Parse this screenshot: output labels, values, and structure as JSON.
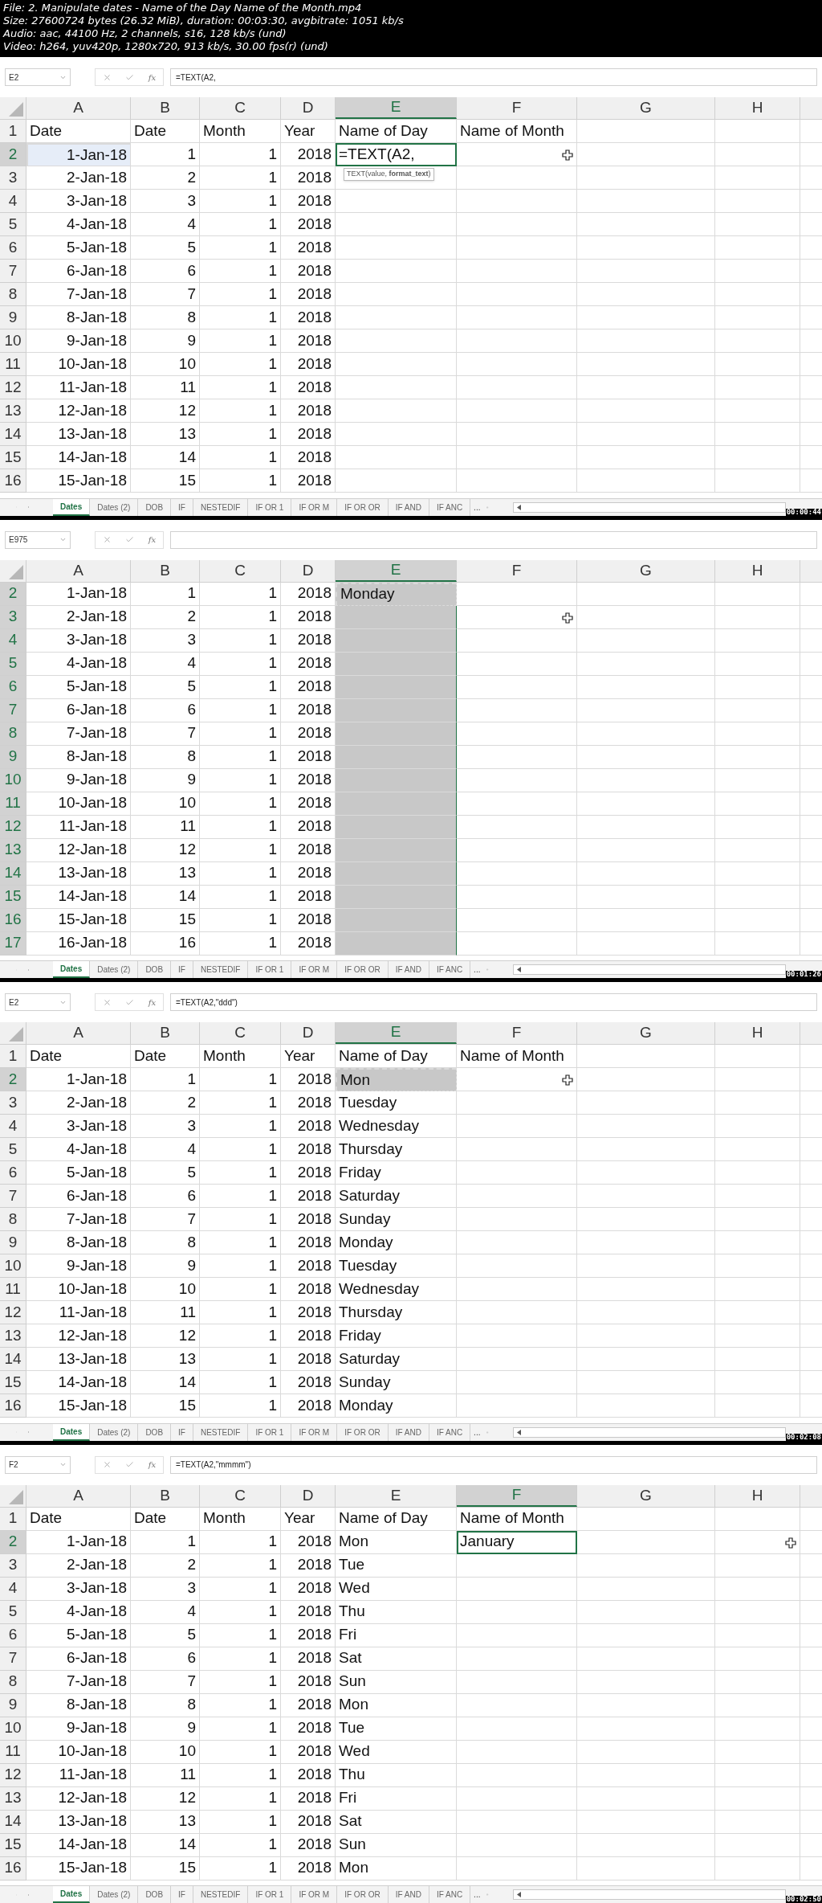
{
  "file_info": [
    "File: 2. Manipulate dates - Name of the Day  Name of the Month.mp4",
    "Size: 27600724 bytes (26.32 MiB), duration: 00:03:30, avgbitrate: 1051 kb/s",
    "Audio: aac, 44100 Hz, 2 channels, s16, 128 kb/s (und)",
    "Video: h264, yuv420p, 1280x720, 913 kb/s, 30.00 fps(r) (und)"
  ],
  "frames": [
    {
      "name_box": "E2",
      "function_label": "fx",
      "formula": "=TEXT(A2,",
      "timestamp": "00:00:44",
      "columns": [
        {
          "label": "A",
          "selected": false
        },
        {
          "label": "B",
          "selected": false
        },
        {
          "label": "C",
          "selected": false
        },
        {
          "label": "D",
          "selected": false
        },
        {
          "label": "E",
          "selected": true
        },
        {
          "label": "F",
          "selected": false
        },
        {
          "label": "G",
          "selected": false
        },
        {
          "label": "H",
          "selected": false
        }
      ],
      "rows": [
        {
          "number": "1",
          "kind": "header",
          "selected": false,
          "cells": [
            "Date",
            "Date",
            "Month",
            "Year",
            "Name of Day",
            "Name of Month"
          ]
        },
        {
          "number": "2",
          "kind": "data",
          "selected": true,
          "cells": [
            {
              "text": "1-Jan-18",
              "kind": "reference"
            },
            "1",
            "1",
            "2018",
            {
              "text": "=TEXT(A2,",
              "kind": "edit",
              "tooltip": "TEXT(value, **format_text**)"
            },
            {
              "kind": "cursor"
            }
          ]
        },
        {
          "number": "3",
          "kind": "data",
          "selected": false,
          "cells": [
            "2-Jan-18",
            "2",
            "1",
            "2018"
          ]
        },
        {
          "number": "4",
          "kind": "data",
          "selected": false,
          "cells": [
            "3-Jan-18",
            "3",
            "1",
            "2018"
          ]
        },
        {
          "number": "5",
          "kind": "data",
          "selected": false,
          "cells": [
            "4-Jan-18",
            "4",
            "1",
            "2018"
          ]
        },
        {
          "number": "6",
          "kind": "data",
          "selected": false,
          "cells": [
            "5-Jan-18",
            "5",
            "1",
            "2018"
          ]
        },
        {
          "number": "7",
          "kind": "data",
          "selected": false,
          "cells": [
            "6-Jan-18",
            "6",
            "1",
            "2018"
          ]
        },
        {
          "number": "8",
          "kind": "data",
          "selected": false,
          "cells": [
            "7-Jan-18",
            "7",
            "1",
            "2018"
          ]
        },
        {
          "number": "9",
          "kind": "data",
          "selected": false,
          "cells": [
            "8-Jan-18",
            "8",
            "1",
            "2018"
          ]
        },
        {
          "number": "10",
          "kind": "data",
          "selected": false,
          "cells": [
            "9-Jan-18",
            "9",
            "1",
            "2018"
          ]
        },
        {
          "number": "11",
          "kind": "data",
          "selected": false,
          "cells": [
            "10-Jan-18",
            "10",
            "1",
            "2018"
          ]
        },
        {
          "number": "12",
          "kind": "data",
          "selected": false,
          "cells": [
            "11-Jan-18",
            "11",
            "1",
            "2018"
          ]
        },
        {
          "number": "13",
          "kind": "data",
          "selected": false,
          "cells": [
            "12-Jan-18",
            "12",
            "1",
            "2018"
          ]
        },
        {
          "number": "14",
          "kind": "data",
          "selected": false,
          "cells": [
            "13-Jan-18",
            "13",
            "1",
            "2018"
          ]
        },
        {
          "number": "15",
          "kind": "data",
          "selected": false,
          "cells": [
            "14-Jan-18",
            "14",
            "1",
            "2018"
          ]
        },
        {
          "number": "16",
          "kind": "data",
          "selected": false,
          "cells": [
            "15-Jan-18",
            "15",
            "1",
            "2018"
          ]
        }
      ],
      "tabs": [
        {
          "label": "Dates",
          "selected": true
        },
        {
          "label": "Dates (2)",
          "selected": false
        },
        {
          "label": "DOB",
          "selected": false
        },
        {
          "label": "IF",
          "selected": false
        },
        {
          "label": "NESTEDIF",
          "selected": false
        },
        {
          "label": "IF OR 1",
          "selected": false
        },
        {
          "label": "IF OR M",
          "selected": false
        },
        {
          "label": "IF OR OR",
          "selected": false
        },
        {
          "label": "IF AND",
          "selected": false
        },
        {
          "label": "IF ANC",
          "selected": false
        }
      ],
      "more_tabs": "..."
    },
    {
      "name_box": "E975",
      "function_label": "fx",
      "timestamp": "00:01:26",
      "columns": [
        {
          "label": "A",
          "selected": false
        },
        {
          "label": "B",
          "selected": false
        },
        {
          "label": "C",
          "selected": false
        },
        {
          "label": "D",
          "selected": false
        },
        {
          "label": "E",
          "selected": true
        },
        {
          "label": "F",
          "selected": false
        },
        {
          "label": "G",
          "selected": false
        },
        {
          "label": "H",
          "selected": false
        }
      ],
      "rows": [
        {
          "number": "2",
          "kind": "data",
          "selected": true,
          "cells": [
            "1-Jan-18",
            "1",
            "1",
            "2018",
            {
              "text": "Monday",
              "kind": "copy"
            }
          ]
        },
        {
          "number": "3",
          "kind": "data",
          "selected": true,
          "cells": [
            "2-Jan-18",
            "2",
            "1",
            "2018",
            {
              "kind": "range"
            },
            {
              "kind": "cursor"
            }
          ]
        },
        {
          "number": "4",
          "kind": "data",
          "selected": true,
          "cells": [
            "3-Jan-18",
            "3",
            "1",
            "2018",
            {
              "kind": "range"
            }
          ]
        },
        {
          "number": "5",
          "kind": "data",
          "selected": true,
          "cells": [
            "4-Jan-18",
            "4",
            "1",
            "2018",
            {
              "kind": "range"
            }
          ]
        },
        {
          "number": "6",
          "kind": "data",
          "selected": true,
          "cells": [
            "5-Jan-18",
            "5",
            "1",
            "2018",
            {
              "kind": "range"
            }
          ]
        },
        {
          "number": "7",
          "kind": "data",
          "selected": true,
          "cells": [
            "6-Jan-18",
            "6",
            "1",
            "2018",
            {
              "kind": "range"
            }
          ]
        },
        {
          "number": "8",
          "kind": "data",
          "selected": true,
          "cells": [
            "7-Jan-18",
            "7",
            "1",
            "2018",
            {
              "kind": "range"
            }
          ]
        },
        {
          "number": "9",
          "kind": "data",
          "selected": true,
          "cells": [
            "8-Jan-18",
            "8",
            "1",
            "2018",
            {
              "kind": "range"
            }
          ]
        },
        {
          "number": "10",
          "kind": "data",
          "selected": true,
          "cells": [
            "9-Jan-18",
            "9",
            "1",
            "2018",
            {
              "kind": "range"
            }
          ]
        },
        {
          "number": "11",
          "kind": "data",
          "selected": true,
          "cells": [
            "10-Jan-18",
            "10",
            "1",
            "2018",
            {
              "kind": "range"
            }
          ]
        },
        {
          "number": "12",
          "kind": "data",
          "selected": true,
          "cells": [
            "11-Jan-18",
            "11",
            "1",
            "2018",
            {
              "kind": "range"
            }
          ]
        },
        {
          "number": "13",
          "kind": "data",
          "selected": true,
          "cells": [
            "12-Jan-18",
            "12",
            "1",
            "2018",
            {
              "kind": "range"
            }
          ]
        },
        {
          "number": "14",
          "kind": "data",
          "selected": true,
          "cells": [
            "13-Jan-18",
            "13",
            "1",
            "2018",
            {
              "kind": "range"
            }
          ]
        },
        {
          "number": "15",
          "kind": "data",
          "selected": true,
          "cells": [
            "14-Jan-18",
            "14",
            "1",
            "2018",
            {
              "kind": "range"
            }
          ]
        },
        {
          "number": "16",
          "kind": "data",
          "selected": true,
          "cells": [
            "15-Jan-18",
            "15",
            "1",
            "2018",
            {
              "kind": "range"
            }
          ]
        },
        {
          "number": "17",
          "kind": "data",
          "selected": true,
          "cells": [
            "16-Jan-18",
            "16",
            "1",
            "2018",
            {
              "kind": "range"
            }
          ]
        }
      ],
      "tabs": [
        {
          "label": "Dates",
          "selected": true
        },
        {
          "label": "Dates (2)",
          "selected": false
        },
        {
          "label": "DOB",
          "selected": false
        },
        {
          "label": "IF",
          "selected": false
        },
        {
          "label": "NESTEDIF",
          "selected": false
        },
        {
          "label": "IF OR 1",
          "selected": false
        },
        {
          "label": "IF OR M",
          "selected": false
        },
        {
          "label": "IF OR OR",
          "selected": false
        },
        {
          "label": "IF AND",
          "selected": false
        },
        {
          "label": "IF ANC",
          "selected": false
        }
      ],
      "more_tabs": "..."
    },
    {
      "name_box": "E2",
      "function_label": "fx",
      "formula": "=TEXT(A2,\"ddd\")",
      "timestamp": "00:02:08",
      "columns": [
        {
          "label": "A",
          "selected": false
        },
        {
          "label": "B",
          "selected": false
        },
        {
          "label": "C",
          "selected": false
        },
        {
          "label": "D",
          "selected": false
        },
        {
          "label": "E",
          "selected": true
        },
        {
          "label": "F",
          "selected": false
        },
        {
          "label": "G",
          "selected": false
        },
        {
          "label": "H",
          "selected": false
        }
      ],
      "rows": [
        {
          "number": "1",
          "kind": "header",
          "selected": false,
          "cells": [
            "Date",
            "Date",
            "Month",
            "Year",
            "Name of Day",
            "Name of Month"
          ]
        },
        {
          "number": "2",
          "kind": "data",
          "selected": true,
          "cells": [
            "1-Jan-18",
            "1",
            "1",
            "2018",
            {
              "text": "Mon",
              "kind": "copy"
            },
            {
              "kind": "cursor"
            }
          ]
        },
        {
          "number": "3",
          "kind": "data",
          "selected": false,
          "cells": [
            "2-Jan-18",
            "2",
            "1",
            "2018",
            "Tuesday"
          ]
        },
        {
          "number": "4",
          "kind": "data",
          "selected": false,
          "cells": [
            "3-Jan-18",
            "3",
            "1",
            "2018",
            "Wednesday"
          ]
        },
        {
          "number": "5",
          "kind": "data",
          "selected": false,
          "cells": [
            "4-Jan-18",
            "4",
            "1",
            "2018",
            "Thursday"
          ]
        },
        {
          "number": "6",
          "kind": "data",
          "selected": false,
          "cells": [
            "5-Jan-18",
            "5",
            "1",
            "2018",
            "Friday"
          ]
        },
        {
          "number": "7",
          "kind": "data",
          "selected": false,
          "cells": [
            "6-Jan-18",
            "6",
            "1",
            "2018",
            "Saturday"
          ]
        },
        {
          "number": "8",
          "kind": "data",
          "selected": false,
          "cells": [
            "7-Jan-18",
            "7",
            "1",
            "2018",
            "Sunday"
          ]
        },
        {
          "number": "9",
          "kind": "data",
          "selected": false,
          "cells": [
            "8-Jan-18",
            "8",
            "1",
            "2018",
            "Monday"
          ]
        },
        {
          "number": "10",
          "kind": "data",
          "selected": false,
          "cells": [
            "9-Jan-18",
            "9",
            "1",
            "2018",
            "Tuesday"
          ]
        },
        {
          "number": "11",
          "kind": "data",
          "selected": false,
          "cells": [
            "10-Jan-18",
            "10",
            "1",
            "2018",
            "Wednesday"
          ]
        },
        {
          "number": "12",
          "kind": "data",
          "selected": false,
          "cells": [
            "11-Jan-18",
            "11",
            "1",
            "2018",
            "Thursday"
          ]
        },
        {
          "number": "13",
          "kind": "data",
          "selected": false,
          "cells": [
            "12-Jan-18",
            "12",
            "1",
            "2018",
            "Friday"
          ]
        },
        {
          "number": "14",
          "kind": "data",
          "selected": false,
          "cells": [
            "13-Jan-18",
            "13",
            "1",
            "2018",
            "Saturday"
          ]
        },
        {
          "number": "15",
          "kind": "data",
          "selected": false,
          "cells": [
            "14-Jan-18",
            "14",
            "1",
            "2018",
            "Sunday"
          ]
        },
        {
          "number": "16",
          "kind": "data",
          "selected": false,
          "cells": [
            "15-Jan-18",
            "15",
            "1",
            "2018",
            "Monday"
          ]
        }
      ],
      "tabs": [
        {
          "label": "Dates",
          "selected": true
        },
        {
          "label": "Dates (2)",
          "selected": false
        },
        {
          "label": "DOB",
          "selected": false
        },
        {
          "label": "IF",
          "selected": false
        },
        {
          "label": "NESTEDIF",
          "selected": false
        },
        {
          "label": "IF OR 1",
          "selected": false
        },
        {
          "label": "IF OR M",
          "selected": false
        },
        {
          "label": "IF OR OR",
          "selected": false
        },
        {
          "label": "IF AND",
          "selected": false
        },
        {
          "label": "IF ANC",
          "selected": false
        }
      ],
      "more_tabs": "..."
    },
    {
      "name_box": "F2",
      "function_label": "fx",
      "formula": "=TEXT(A2,\"mmmm\")",
      "timestamp": "00:02:50",
      "columns": [
        {
          "label": "A",
          "selected": false
        },
        {
          "label": "B",
          "selected": false
        },
        {
          "label": "C",
          "selected": false
        },
        {
          "label": "D",
          "selected": false
        },
        {
          "label": "E",
          "selected": false
        },
        {
          "label": "F",
          "selected": true
        },
        {
          "label": "G",
          "selected": false
        },
        {
          "label": "H",
          "selected": false
        }
      ],
      "rows": [
        {
          "number": "1",
          "kind": "header",
          "selected": false,
          "cells": [
            "Date",
            "Date",
            "Month",
            "Year",
            "Name of Day",
            "Name of Month"
          ]
        },
        {
          "number": "2",
          "kind": "data",
          "selected": true,
          "cells": [
            "1-Jan-18",
            "1",
            "1",
            "2018",
            "Mon",
            {
              "text": "January",
              "kind": "active"
            },
            {},
            {
              "kind": "cursor"
            }
          ]
        },
        {
          "number": "3",
          "kind": "data",
          "selected": false,
          "cells": [
            "2-Jan-18",
            "2",
            "1",
            "2018",
            "Tue"
          ]
        },
        {
          "number": "4",
          "kind": "data",
          "selected": false,
          "cells": [
            "3-Jan-18",
            "3",
            "1",
            "2018",
            "Wed"
          ]
        },
        {
          "number": "5",
          "kind": "data",
          "selected": false,
          "cells": [
            "4-Jan-18",
            "4",
            "1",
            "2018",
            "Thu"
          ]
        },
        {
          "number": "6",
          "kind": "data",
          "selected": false,
          "cells": [
            "5-Jan-18",
            "5",
            "1",
            "2018",
            "Fri"
          ]
        },
        {
          "number": "7",
          "kind": "data",
          "selected": false,
          "cells": [
            "6-Jan-18",
            "6",
            "1",
            "2018",
            "Sat"
          ]
        },
        {
          "number": "8",
          "kind": "data",
          "selected": false,
          "cells": [
            "7-Jan-18",
            "7",
            "1",
            "2018",
            "Sun"
          ]
        },
        {
          "number": "9",
          "kind": "data",
          "selected": false,
          "cells": [
            "8-Jan-18",
            "8",
            "1",
            "2018",
            "Mon"
          ]
        },
        {
          "number": "10",
          "kind": "data",
          "selected": false,
          "cells": [
            "9-Jan-18",
            "9",
            "1",
            "2018",
            "Tue"
          ]
        },
        {
          "number": "11",
          "kind": "data",
          "selected": false,
          "cells": [
            "10-Jan-18",
            "10",
            "1",
            "2018",
            "Wed"
          ]
        },
        {
          "number": "12",
          "kind": "data",
          "selected": false,
          "cells": [
            "11-Jan-18",
            "11",
            "1",
            "2018",
            "Thu"
          ]
        },
        {
          "number": "13",
          "kind": "data",
          "selected": false,
          "cells": [
            "12-Jan-18",
            "12",
            "1",
            "2018",
            "Fri"
          ]
        },
        {
          "number": "14",
          "kind": "data",
          "selected": false,
          "cells": [
            "13-Jan-18",
            "13",
            "1",
            "2018",
            "Sat"
          ]
        },
        {
          "number": "15",
          "kind": "data",
          "selected": false,
          "cells": [
            "14-Jan-18",
            "14",
            "1",
            "2018",
            "Sun"
          ]
        },
        {
          "number": "16",
          "kind": "data",
          "selected": false,
          "cells": [
            "15-Jan-18",
            "15",
            "1",
            "2018",
            "Mon"
          ]
        }
      ],
      "tabs": [
        {
          "label": "Dates",
          "selected": true
        },
        {
          "label": "Dates (2)",
          "selected": false
        },
        {
          "label": "DOB",
          "selected": false
        },
        {
          "label": "IF",
          "selected": false
        },
        {
          "label": "NESTEDIF",
          "selected": false
        },
        {
          "label": "IF OR 1",
          "selected": false
        },
        {
          "label": "IF OR M",
          "selected": false
        },
        {
          "label": "IF OR OR",
          "selected": false
        },
        {
          "label": "IF AND",
          "selected": false
        },
        {
          "label": "IF ANC",
          "selected": false
        }
      ],
      "more_tabs": "..."
    }
  ]
}
